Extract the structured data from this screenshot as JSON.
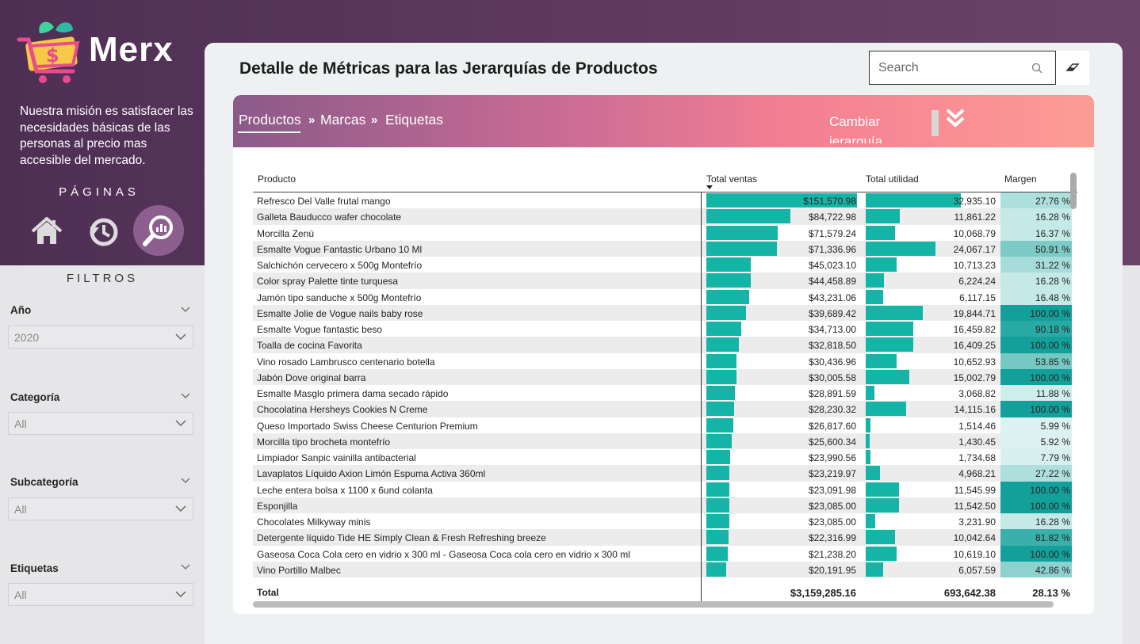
{
  "brand": {
    "name": "Merx"
  },
  "sidebar": {
    "mission": "Nuestra misión es satisfacer las necesidades básicas de las personas al precio mas accesible del mercado.",
    "pages_title": "PÁGINAS",
    "filters_title": "FILTROS",
    "filters": [
      {
        "label": "Año",
        "value": "2020"
      },
      {
        "label": "Categoría",
        "value": "All"
      },
      {
        "label": "Subcategoría",
        "value": "All"
      },
      {
        "label": "Etiquetas",
        "value": "All"
      }
    ]
  },
  "main": {
    "title": "Detalle de Métricas para las Jerarquías de Productos",
    "search_placeholder": "Search",
    "breadcrumb": [
      "Productos",
      "Marcas",
      "Etiquetas"
    ],
    "breadcrumb_sep": "»",
    "change_hierarchy": "Cambiar jerarquía",
    "accent_color": "#14b4a7"
  },
  "table": {
    "headers": {
      "product": "Producto",
      "sales": "Total ventas",
      "profit": "Total utilidad",
      "margin": "Margen"
    },
    "rows": [
      {
        "p": "Refresco Del Valle frutal mango",
        "s": "$151,570.98",
        "sv": 151570.98,
        "u": "32,935.10",
        "uv": 32935.1,
        "m": "27.76 %",
        "mv": 27.76
      },
      {
        "p": "Galleta Bauducco wafer chocolate",
        "s": "$84,722.98",
        "sv": 84722.98,
        "u": "11,861.22",
        "uv": 11861.22,
        "m": "16.28 %",
        "mv": 16.28
      },
      {
        "p": "Morcilla Zenú",
        "s": "$71,579.24",
        "sv": 71579.24,
        "u": "10,068.79",
        "uv": 10068.79,
        "m": "16.37 %",
        "mv": 16.37
      },
      {
        "p": "Esmalte Vogue Fantastic Urbano 10 Ml",
        "s": "$71,336.96",
        "sv": 71336.96,
        "u": "24,067.17",
        "uv": 24067.17,
        "m": "50.91 %",
        "mv": 50.91
      },
      {
        "p": "Salchichón cervecero x 500g Montefrío",
        "s": "$45,023.10",
        "sv": 45023.1,
        "u": "10,713.23",
        "uv": 10713.23,
        "m": "31.22 %",
        "mv": 31.22
      },
      {
        "p": "Color spray Palette tinte turquesa",
        "s": "$44,458.89",
        "sv": 44458.89,
        "u": "6,224.24",
        "uv": 6224.24,
        "m": "16.28 %",
        "mv": 16.28
      },
      {
        "p": "Jamón tipo sanduche x 500g Montefrío",
        "s": "$43,231.06",
        "sv": 43231.06,
        "u": "6,117.15",
        "uv": 6117.15,
        "m": "16.48 %",
        "mv": 16.48
      },
      {
        "p": "Esmalte Jolie de Vogue nails baby rose",
        "s": "$39,689.42",
        "sv": 39689.42,
        "u": "19,844.71",
        "uv": 19844.71,
        "m": "100.00 %",
        "mv": 100.0
      },
      {
        "p": "Esmalte Vogue fantastic beso",
        "s": "$34,713.00",
        "sv": 34713.0,
        "u": "16,459.82",
        "uv": 16459.82,
        "m": "90.18 %",
        "mv": 90.18
      },
      {
        "p": "Toalla de cocina Favorita",
        "s": "$32,818.50",
        "sv": 32818.5,
        "u": "16,409.25",
        "uv": 16409.25,
        "m": "100.00 %",
        "mv": 100.0
      },
      {
        "p": "Vino rosado Lambrusco centenario botella",
        "s": "$30,436.96",
        "sv": 30436.96,
        "u": "10,652.93",
        "uv": 10652.93,
        "m": "53.85 %",
        "mv": 53.85
      },
      {
        "p": "Jabón Dove original barra",
        "s": "$30,005.58",
        "sv": 30005.58,
        "u": "15,002.79",
        "uv": 15002.79,
        "m": "100.00 %",
        "mv": 100.0
      },
      {
        "p": "Esmalte Masglo primera dama secado rápido",
        "s": "$28,891.59",
        "sv": 28891.59,
        "u": "3,068.82",
        "uv": 3068.82,
        "m": "11.88 %",
        "mv": 11.88
      },
      {
        "p": "Chocolatina Hersheys Cookies N Creme",
        "s": "$28,230.32",
        "sv": 28230.32,
        "u": "14,115.16",
        "uv": 14115.16,
        "m": "100.00 %",
        "mv": 100.0
      },
      {
        "p": "Queso Importado Swiss Cheese Centurion Premium",
        "s": "$26,817.60",
        "sv": 26817.6,
        "u": "1,514.46",
        "uv": 1514.46,
        "m": "5.99 %",
        "mv": 5.99
      },
      {
        "p": "Morcilla tipo brocheta montefrío",
        "s": "$25,600.34",
        "sv": 25600.34,
        "u": "1,430.45",
        "uv": 1430.45,
        "m": "5.92 %",
        "mv": 5.92
      },
      {
        "p": "Limpiador Sanpic vainilla antibacterial",
        "s": "$23,990.56",
        "sv": 23990.56,
        "u": "1,734.68",
        "uv": 1734.68,
        "m": "7.79 %",
        "mv": 7.79
      },
      {
        "p": "Lavaplatos Líquido Axion Limón Espuma Activa 360ml",
        "s": "$23,219.97",
        "sv": 23219.97,
        "u": "4,968.21",
        "uv": 4968.21,
        "m": "27.22 %",
        "mv": 27.22
      },
      {
        "p": "Leche entera bolsa x 1100 x 6und colanta",
        "s": "$23,091.98",
        "sv": 23091.98,
        "u": "11,545.99",
        "uv": 11545.99,
        "m": "100.00 %",
        "mv": 100.0
      },
      {
        "p": "Esponjilla",
        "s": "$23,085.00",
        "sv": 23085.0,
        "u": "11,542.50",
        "uv": 11542.5,
        "m": "100.00 %",
        "mv": 100.0
      },
      {
        "p": "Chocolates Milkyway minis",
        "s": "$23,085.00",
        "sv": 23085.0,
        "u": "3,231.90",
        "uv": 3231.9,
        "m": "16.28 %",
        "mv": 16.28
      },
      {
        "p": "Detergente líquido Tide HE Simply Clean & Fresh Refreshing breeze",
        "s": "$22,316.99",
        "sv": 22316.99,
        "u": "10,042.64",
        "uv": 10042.64,
        "m": "81.82 %",
        "mv": 81.82
      },
      {
        "p": "Gaseosa Coca Cola cero en vidrio x 300 ml - Gaseosa Coca cola cero en vidrio x 300 ml",
        "s": "$21,238.20",
        "sv": 21238.2,
        "u": "10,619.10",
        "uv": 10619.1,
        "m": "100.00 %",
        "mv": 100.0
      },
      {
        "p": "Vino Portillo Malbec",
        "s": "$20,191.95",
        "sv": 20191.95,
        "u": "6,057.59",
        "uv": 6057.59,
        "m": "42.86 %",
        "mv": 42.86
      }
    ],
    "total": {
      "label": "Total",
      "sales": "$3,159,285.16",
      "profit": "693,642.38",
      "margin": "28.13 %"
    }
  }
}
